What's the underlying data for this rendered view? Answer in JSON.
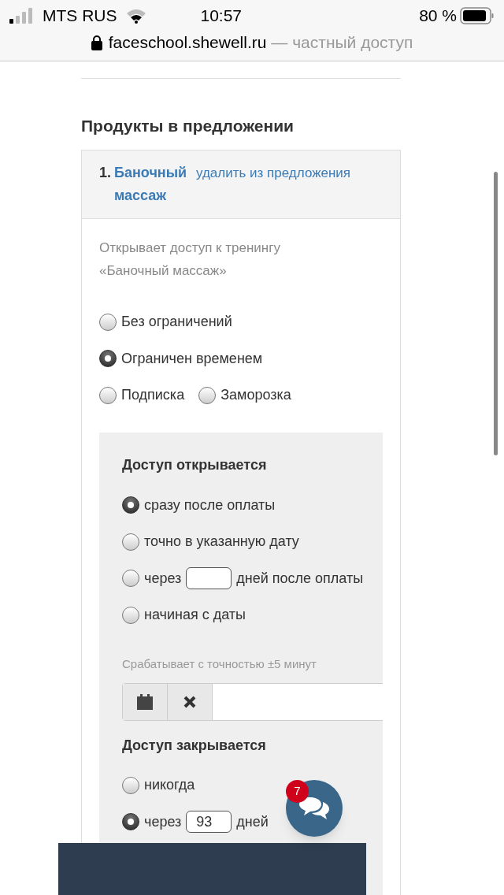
{
  "status_bar": {
    "carrier": "MTS RUS",
    "time": "10:57",
    "battery": "80 %"
  },
  "address_bar": {
    "domain": "faceschool.shewell.ru",
    "suffix": "— частный доступ"
  },
  "section_title": "Продукты в предложении",
  "product": {
    "number": "1.",
    "name": "Баночный массаж",
    "remove_link": "удалить из предложения",
    "description": "Открывает доступ к тренингу «Баночный массаж»",
    "access_types": [
      {
        "label": "Без ограничений",
        "selected": false
      },
      {
        "label": "Ограничен временем",
        "selected": true
      },
      {
        "label": "Подписка",
        "selected": false
      },
      {
        "label": "Заморозка",
        "selected": false
      }
    ],
    "open_title": "Доступ открывается",
    "open_options": [
      {
        "kind": "plain",
        "label": "сразу после оплаты",
        "selected": true
      },
      {
        "kind": "plain",
        "label": "точно в указанную дату",
        "selected": false
      },
      {
        "kind": "days",
        "label": "через",
        "after": "дней после оплаты",
        "selected": false
      },
      {
        "kind": "plain",
        "label": "начиная с даты",
        "selected": false
      }
    ],
    "hint": "Срабатывает с точностью ±5 минут",
    "close_title": "Доступ закрывается",
    "close_options": [
      {
        "kind": "plain",
        "label": "никогда",
        "selected": false
      },
      {
        "kind": "days",
        "label": "через",
        "value": "93",
        "after": "дней",
        "selected": true
      }
    ]
  },
  "chat": {
    "badge": "7"
  }
}
